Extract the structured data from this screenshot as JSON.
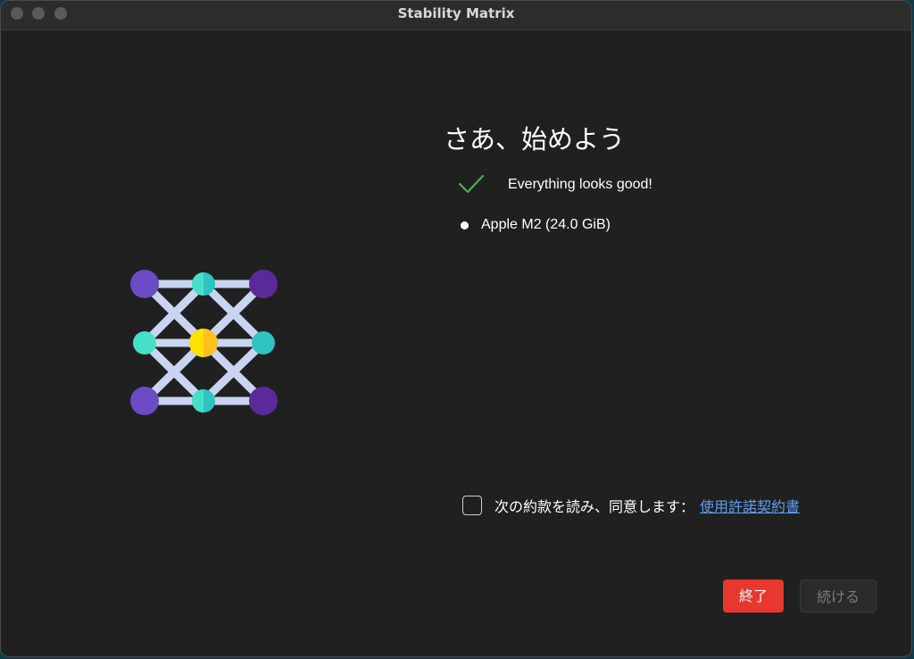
{
  "window": {
    "title": "Stability Matrix"
  },
  "main": {
    "heading": "さあ、始めよう",
    "status_icon": "checkmark-icon",
    "status_text": "Everything looks good!",
    "gpu_info": "Apple M2 (24.0 GiB)"
  },
  "agreement": {
    "text": "次の約款を読み、同意します：",
    "link_label": "使用許諾契約書",
    "checked": false
  },
  "buttons": {
    "quit_label": "終了",
    "continue_label": "続ける"
  },
  "colors": {
    "accent_red": "#e8372f",
    "link_blue": "#5aa0f0",
    "check_green": "#4caf50",
    "logo_purple_light": "#6a4bc4",
    "logo_purple_dark": "#5a2a9a",
    "logo_teal": "#2ec4c0",
    "logo_yellow": "#ffd200",
    "logo_lines": "#c8d4f0"
  }
}
